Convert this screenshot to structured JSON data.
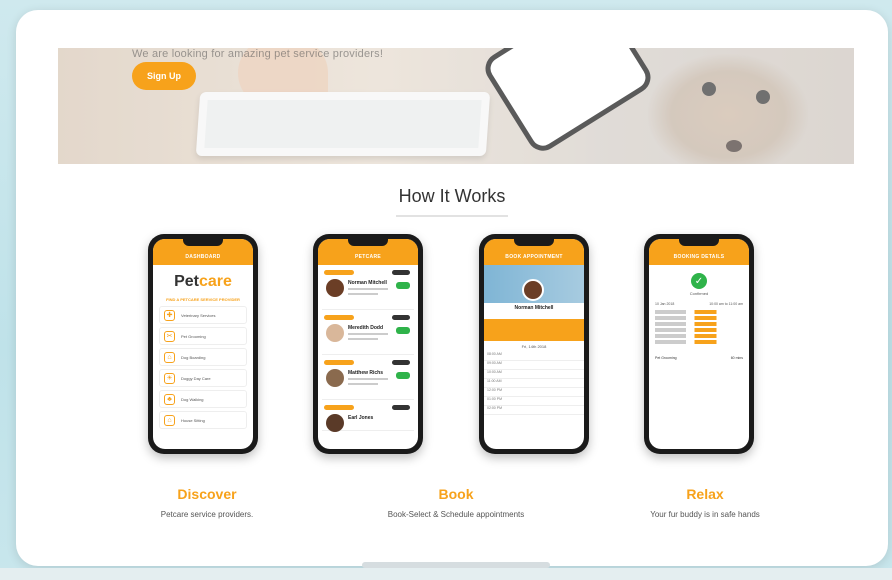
{
  "hero": {
    "tagline": "We are looking for amazing pet service providers!",
    "signup_label": "Sign Up"
  },
  "section": {
    "title": "How It Works"
  },
  "phones": {
    "discover": {
      "appbar": "DASHBOARD",
      "logo_a": "Pet",
      "logo_b": "care",
      "subhead": "FIND A PETCARE SERVICE PROVIDER",
      "services": [
        "Veterinary Services",
        "Pet Grooming",
        "Dog Boarding",
        "Doggy Day Care",
        "Dog Walking",
        "House Sitting"
      ]
    },
    "book_list": {
      "appbar": "PETCARE",
      "providers": [
        "Norman Mitchell",
        "Meredith Dodd",
        "Matthew Richs",
        "Earl Jones"
      ]
    },
    "book_detail": {
      "appbar": "BOOK APPOINTMENT",
      "name": "Norman Mitchell",
      "date": "Fri, 14th 2018",
      "times": [
        "08:00 AM",
        "09:00 AM",
        "10:00 AM",
        "11:00 AM",
        "12:00 PM",
        "01:00 PM",
        "02:00 PM"
      ]
    },
    "relax": {
      "appbar": "BOOKING DETAILS",
      "status": "Confirmed",
      "service": "Pet Grooming",
      "duration": "60 mins",
      "date": "10 Jan 2018",
      "time": "10:00 am to 11:00 am"
    }
  },
  "steps": [
    {
      "title": "Discover",
      "description": "Petcare service providers."
    },
    {
      "title": "Book",
      "description": "Book-Select & Schedule appointments"
    },
    {
      "title": "Relax",
      "description": "Your fur buddy is in safe hands"
    }
  ],
  "colors": {
    "accent": "#f7a21b",
    "success": "#2fb34a",
    "background": "#c8e6ec"
  }
}
